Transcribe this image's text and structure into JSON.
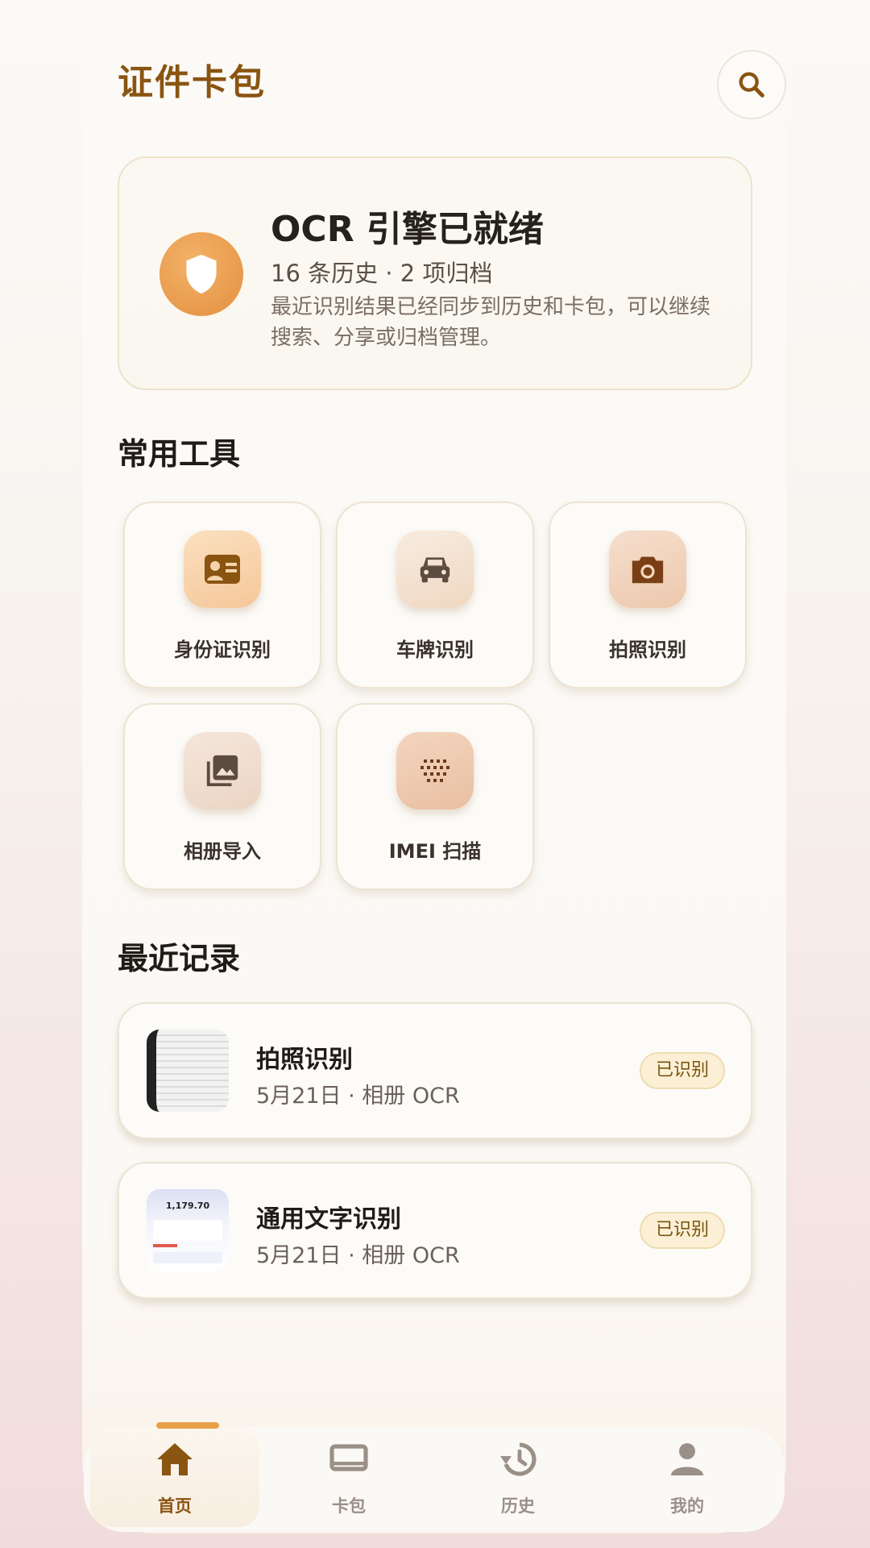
{
  "header": {
    "title": "证件卡包"
  },
  "status_card": {
    "title": "OCR 引擎已就绪",
    "subtitle": "16 条历史 · 2 项归档",
    "description": "最近识别结果已经同步到历史和卡包，可以继续搜索、分享或归档管理。"
  },
  "tools": {
    "section_title": "常用工具",
    "items": [
      {
        "label": "身份证识别",
        "icon": "id-card-icon"
      },
      {
        "label": "车牌识别",
        "icon": "car-icon"
      },
      {
        "label": "拍照识别",
        "icon": "camera-icon"
      },
      {
        "label": "相册导入",
        "icon": "photo-library-icon"
      },
      {
        "label": "IMEI 扫描",
        "icon": "dot-grid-icon"
      }
    ]
  },
  "records": {
    "section_title": "最近记录",
    "items": [
      {
        "title": "拍照识别",
        "meta": "5月21日 · 相册 OCR",
        "status": "已识别"
      },
      {
        "title": "通用文字识别",
        "meta": "5月21日 · 相册 OCR",
        "status": "已识别",
        "thumb_text": "1,179.70"
      }
    ]
  },
  "tabbar": {
    "items": [
      {
        "label": "首页",
        "icon": "home-icon",
        "active": true
      },
      {
        "label": "卡包",
        "icon": "card-icon",
        "active": false
      },
      {
        "label": "历史",
        "icon": "history-icon",
        "active": false
      },
      {
        "label": "我的",
        "icon": "person-icon",
        "active": false
      }
    ]
  },
  "colors": {
    "accent": "#8a5411",
    "accent_orange": "#e89a4c"
  }
}
